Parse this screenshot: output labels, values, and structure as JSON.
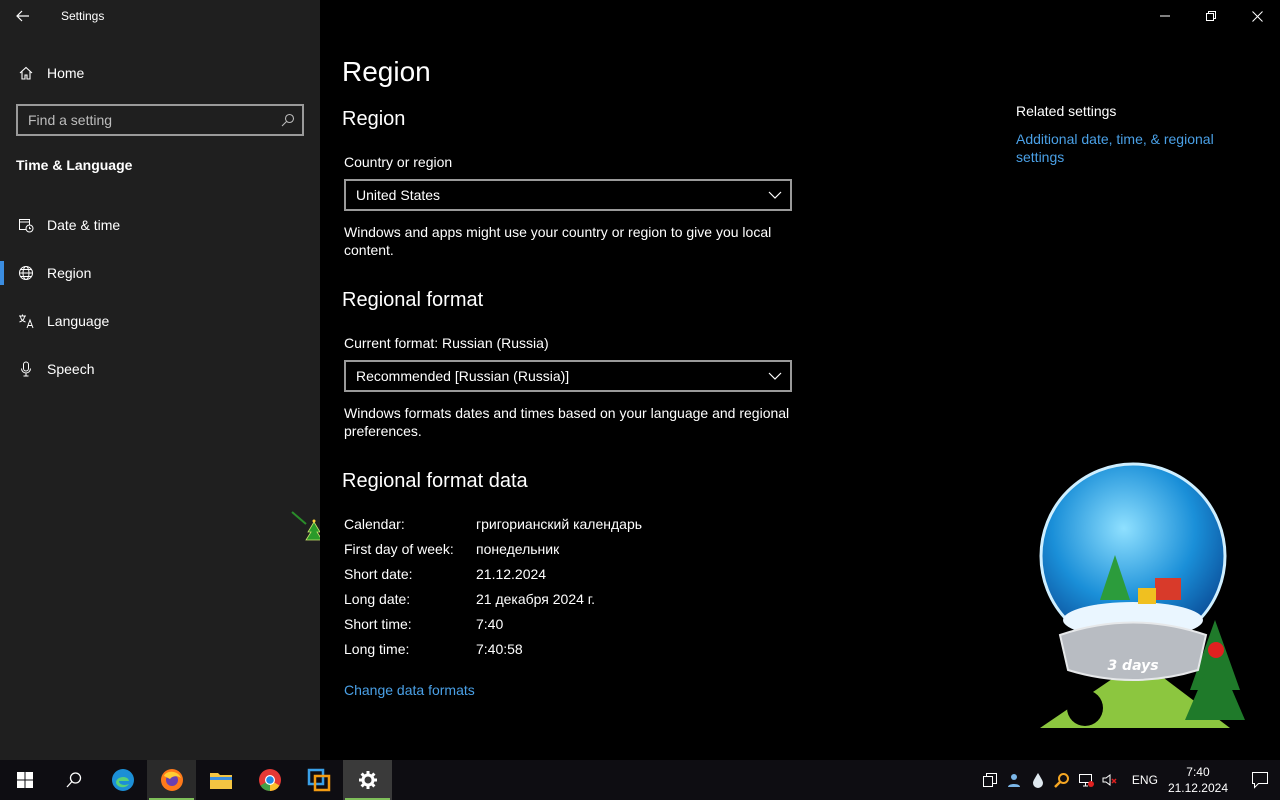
{
  "window": {
    "app_title": "Settings"
  },
  "sidebar": {
    "home_label": "Home",
    "search_placeholder": "Find a setting",
    "section_title": "Time & Language",
    "items": [
      {
        "label": "Date & time",
        "icon": "calendar-clock-icon"
      },
      {
        "label": "Region",
        "icon": "globe-icon",
        "active": true
      },
      {
        "label": "Language",
        "icon": "language-icon"
      },
      {
        "label": "Speech",
        "icon": "microphone-icon"
      }
    ]
  },
  "main": {
    "page_title": "Region",
    "region_heading": "Region",
    "country_label": "Country or region",
    "country_value": "United States",
    "country_desc": "Windows and apps might use your country or region to give you local content.",
    "format_heading": "Regional format",
    "current_format_label": "Current format: Russian (Russia)",
    "format_value": "Recommended [Russian (Russia)]",
    "format_desc": "Windows formats dates and times based on your language and regional preferences.",
    "format_data_heading": "Regional format data",
    "format_data": [
      {
        "key": "Calendar:",
        "value": "григорианский календарь"
      },
      {
        "key": "First day of week:",
        "value": "понедельник"
      },
      {
        "key": "Short date:",
        "value": "21.12.2024"
      },
      {
        "key": "Long date:",
        "value": "21 декабря 2024 г."
      },
      {
        "key": "Short time:",
        "value": "7:40"
      },
      {
        "key": "Long time:",
        "value": "7:40:58"
      }
    ],
    "change_formats_link": "Change data formats"
  },
  "related": {
    "title": "Related settings",
    "link": "Additional date, time, & regional settings"
  },
  "widget": {
    "badge_text": "3 days"
  },
  "taskbar": {
    "apps": [
      "start-icon",
      "search-icon",
      "edge-icon",
      "firefox-icon",
      "file-explorer-icon",
      "chrome-icon",
      "app-icon",
      "settings-icon"
    ],
    "language": "ENG",
    "time": "7:40",
    "date": "21.12.2024"
  },
  "colors": {
    "accent": "#3b8de0",
    "link": "#4aa0e6",
    "sidebar_bg": "#1f1f1f",
    "main_bg": "#000000"
  }
}
